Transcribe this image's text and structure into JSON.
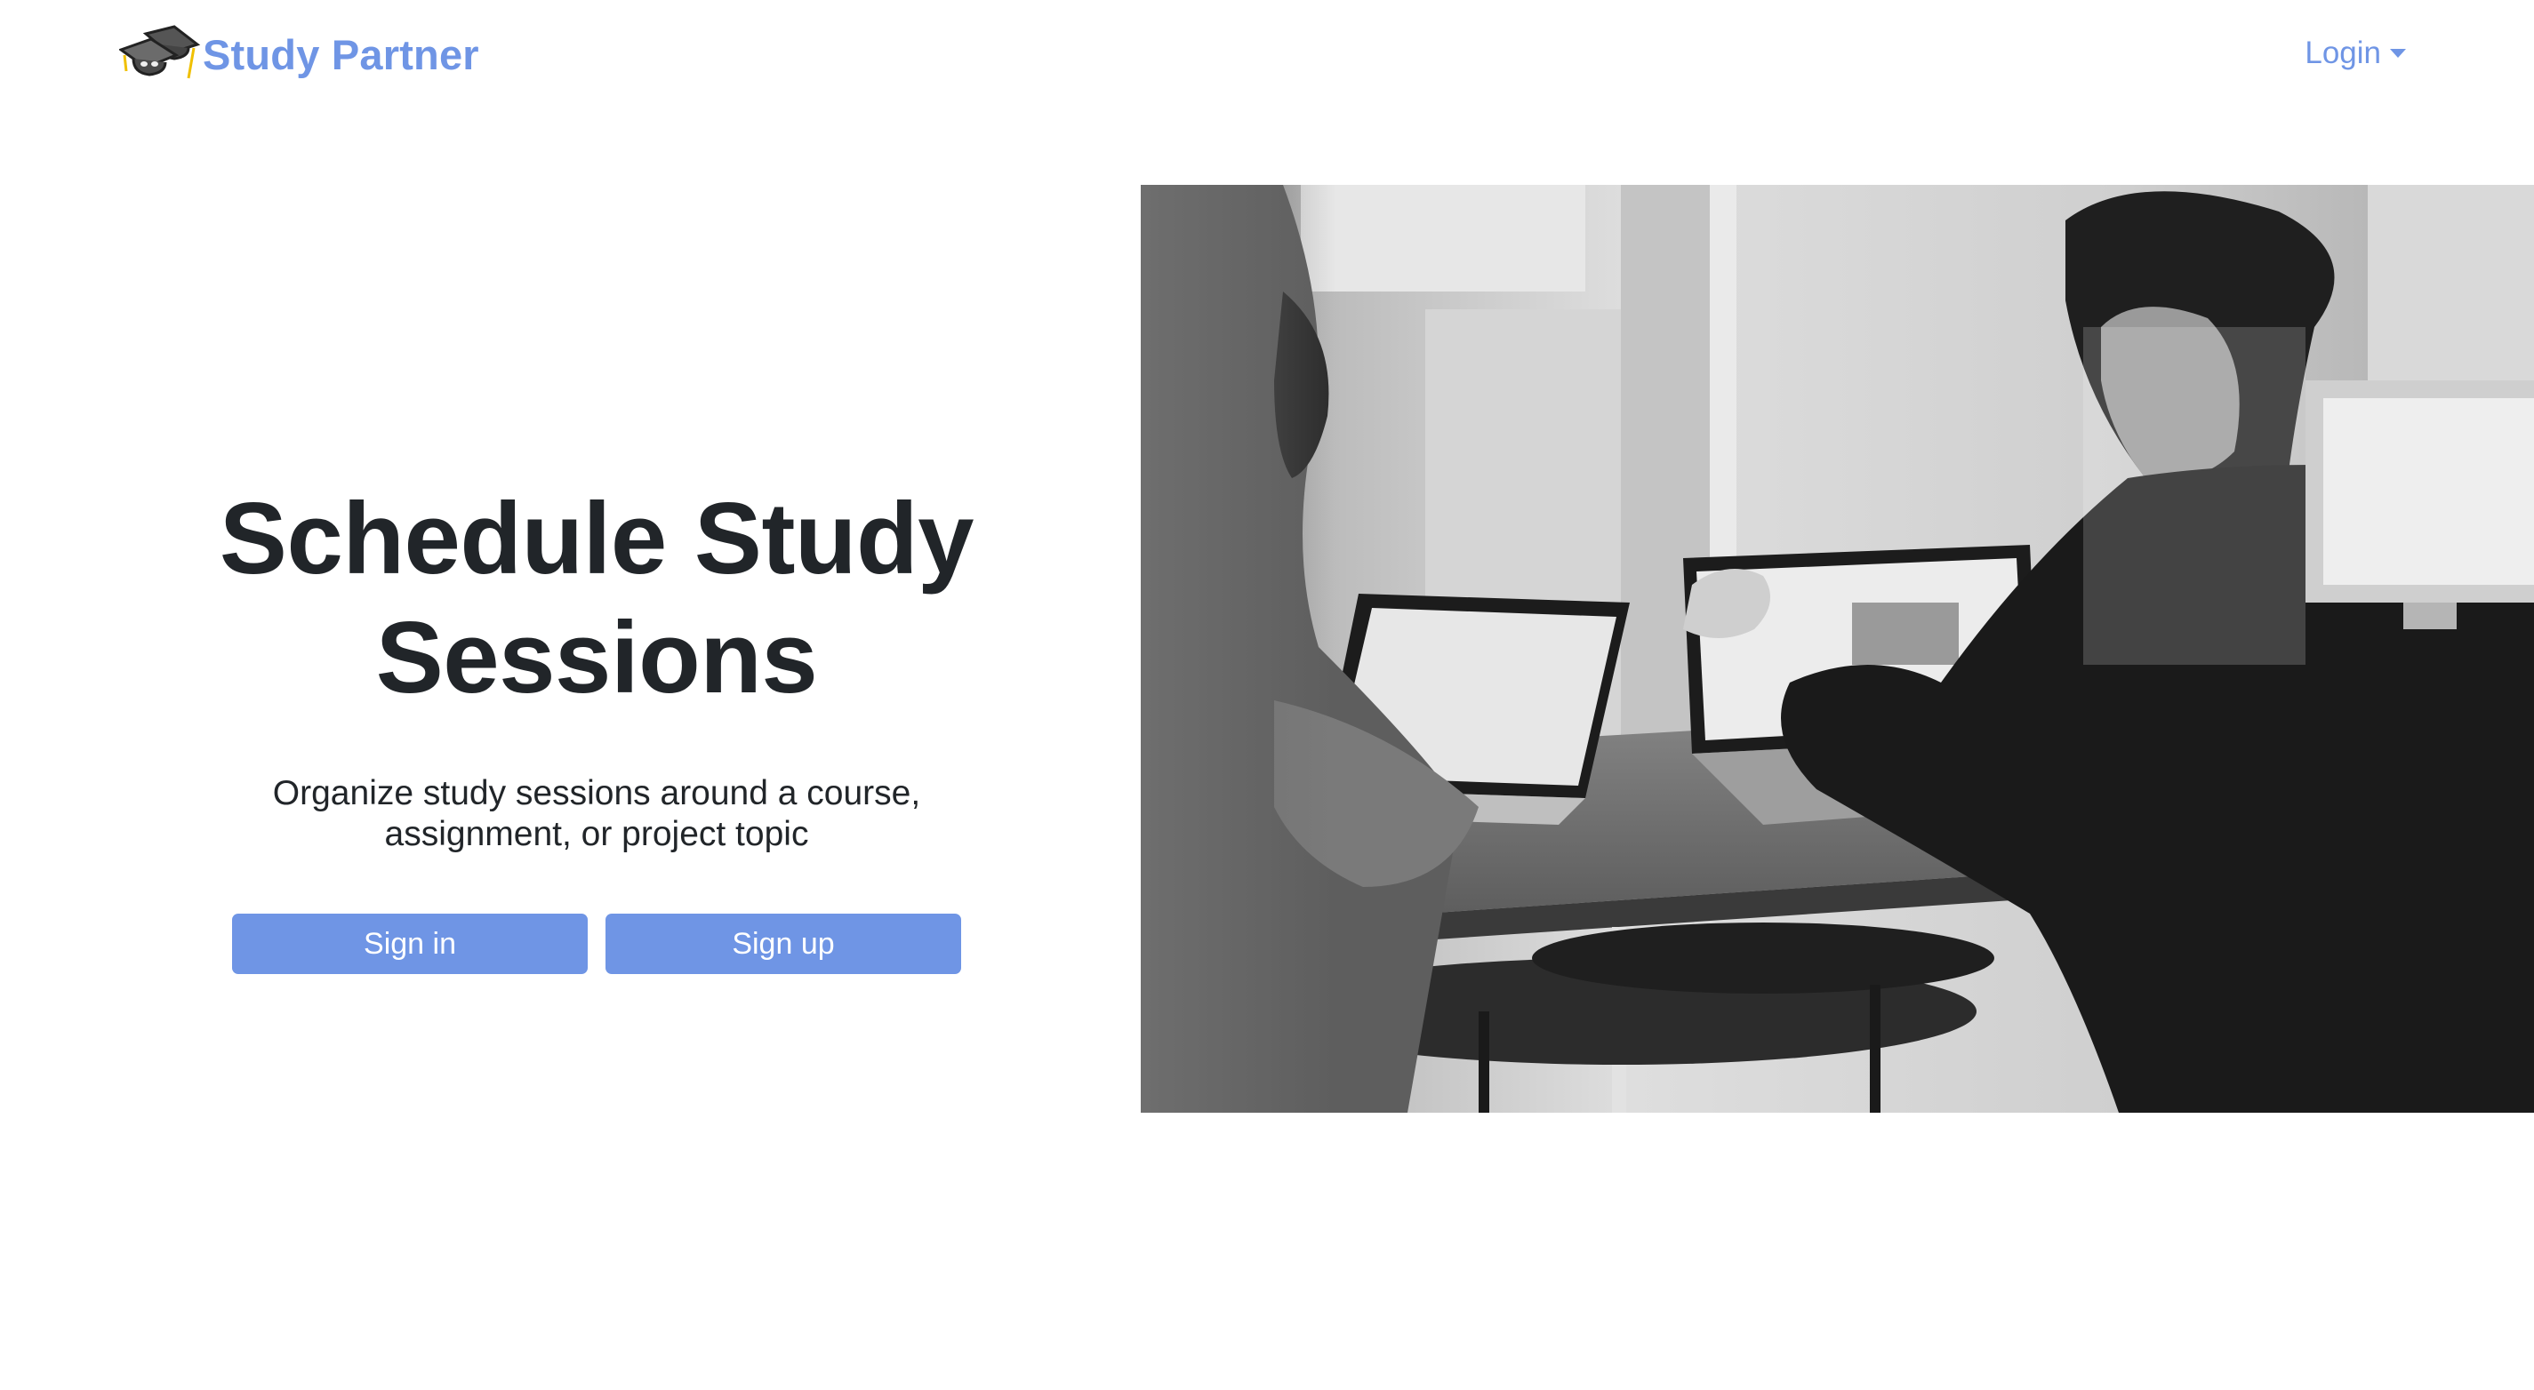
{
  "navbar": {
    "brand_text": "Study Partner",
    "brand_icon": "graduation-cap-icon",
    "login_label": "Login",
    "accent_color": "#6f95e5"
  },
  "hero": {
    "title": "Schedule Study Sessions",
    "subtitle": "Organize study sessions around a course, assignment, or project topic",
    "signin_label": "Sign in",
    "signup_label": "Sign up",
    "image_alt": "Two people working on laptops at a table (black and white photo)"
  }
}
